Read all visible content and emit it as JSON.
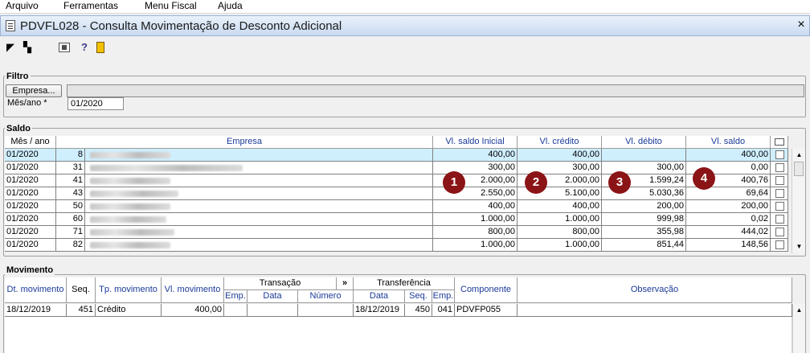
{
  "menu": [
    "Arquivo",
    "Ferramentas",
    "Menu Fiscal",
    "Ajuda"
  ],
  "window": {
    "title": "PDVFL028 - Consulta Movimentação de Desconto Adicional",
    "close_label": "×"
  },
  "filtro": {
    "label": "Filtro",
    "empresa_button": "Empresa...",
    "empresa_value": "",
    "mes_ano_label": "Mês/ano *",
    "mes_ano_value": "01/2020"
  },
  "saldo": {
    "label": "Saldo",
    "columns": [
      "Mês / ano",
      "Empresa",
      "Vl. saldo Inicial",
      "Vl. crédito",
      "Vl. débito",
      "Vl. saldo"
    ],
    "rows": [
      {
        "mes": "01/2020",
        "emp": "8",
        "saldo_inicial": "400,00",
        "credito": "400,00",
        "debito": "",
        "saldo": "400,00"
      },
      {
        "mes": "01/2020",
        "emp": "31",
        "saldo_inicial": "300,00",
        "credito": "300,00",
        "debito": "300,00",
        "saldo": "0,00"
      },
      {
        "mes": "01/2020",
        "emp": "41",
        "saldo_inicial": "2.000,00",
        "credito": "2.000,00",
        "debito": "1.599,24",
        "saldo": "400,76"
      },
      {
        "mes": "01/2020",
        "emp": "43",
        "saldo_inicial": "2.550,00",
        "credito": "5.100,00",
        "debito": "5.030,36",
        "saldo": "69,64"
      },
      {
        "mes": "01/2020",
        "emp": "50",
        "saldo_inicial": "400,00",
        "credito": "400,00",
        "debito": "200,00",
        "saldo": "200,00"
      },
      {
        "mes": "01/2020",
        "emp": "60",
        "saldo_inicial": "1.000,00",
        "credito": "1.000,00",
        "debito": "999,98",
        "saldo": "0,02"
      },
      {
        "mes": "01/2020",
        "emp": "71",
        "saldo_inicial": "800,00",
        "credito": "800,00",
        "debito": "355,98",
        "saldo": "444,02"
      },
      {
        "mes": "01/2020",
        "emp": "82",
        "saldo_inicial": "1.000,00",
        "credito": "1.000,00",
        "debito": "851,44",
        "saldo": "148,56"
      }
    ],
    "badges": [
      "1",
      "2",
      "3",
      "4"
    ]
  },
  "movimento": {
    "label": "Movimento",
    "headers": {
      "dt": "Dt. movimento",
      "seq": "Seq.",
      "tp": "Tp. movimento",
      "vl": "Vl. movimento",
      "transacao": "Transação",
      "expand": "»",
      "transferencia": "Transferência",
      "componente": "Componente",
      "observacao": "Observação",
      "emp": "Emp.",
      "data": "Data",
      "numero": "Número",
      "t_data": "Data",
      "t_seq": "Seq.",
      "t_emp": "Emp."
    },
    "row": {
      "dt": "18/12/2019",
      "seq": "451",
      "tp": "Crédito",
      "vl": "400,00",
      "emp": "",
      "data": "",
      "numero": "",
      "t_data": "18/12/2019",
      "t_seq": "450",
      "t_emp": "041",
      "componente": "PDVFP055",
      "observacao": ""
    }
  }
}
